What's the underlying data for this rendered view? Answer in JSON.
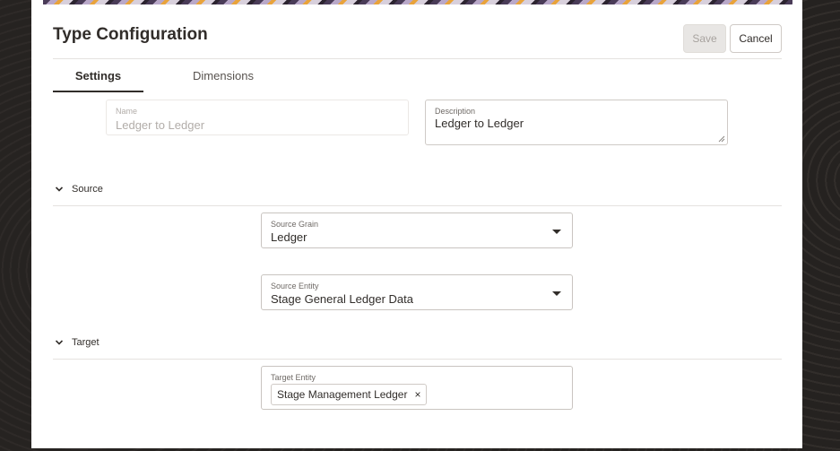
{
  "dialog": {
    "title": "Type Configuration",
    "save_label": "Save",
    "cancel_label": "Cancel"
  },
  "tabs": [
    {
      "label": "Settings",
      "active": true
    },
    {
      "label": "Dimensions",
      "active": false
    }
  ],
  "fields": {
    "name": {
      "label": "Name",
      "value": "Ledger to Ledger"
    },
    "description": {
      "label": "Description",
      "value": "Ledger to Ledger"
    }
  },
  "sections": {
    "source": {
      "label": "Source",
      "grain": {
        "label": "Source Grain",
        "value": "Ledger"
      },
      "entity": {
        "label": "Source Entity",
        "value": "Stage General Ledger Data"
      }
    },
    "target": {
      "label": "Target",
      "entity": {
        "label": "Target Entity",
        "chip": "Stage Management Ledger",
        "remove": "×"
      }
    }
  },
  "colors": {
    "text": "#312d2a",
    "disabled_button": "#e8e6e4",
    "border": "#d4d0cc"
  }
}
